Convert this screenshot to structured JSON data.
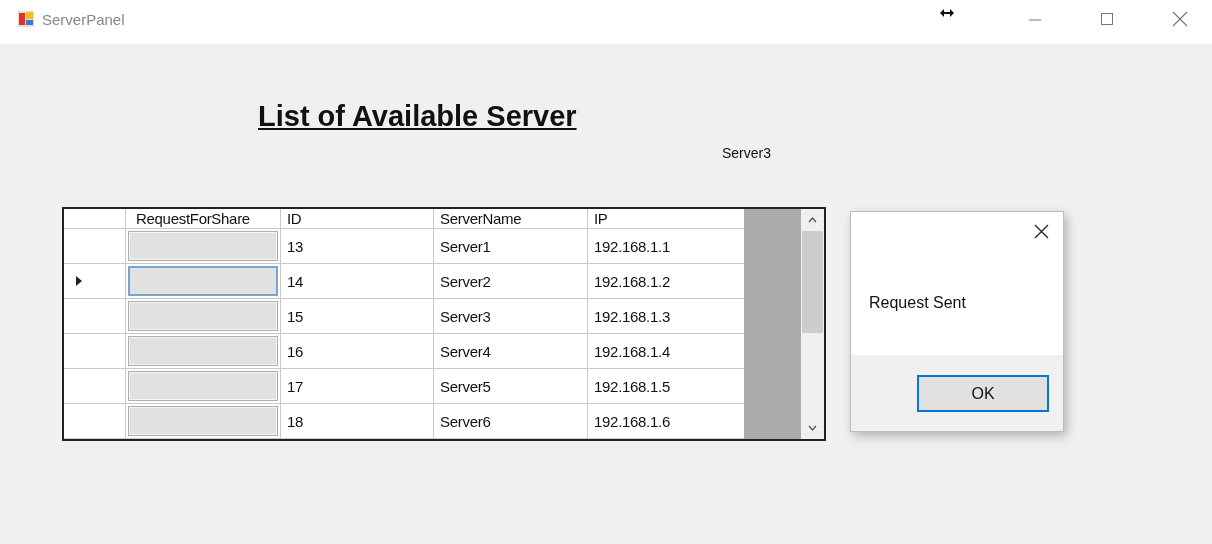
{
  "window": {
    "title": "ServerPanel"
  },
  "heading": "List of Available Server",
  "selected_server": "Server3",
  "table": {
    "columns": [
      "RequestForShare",
      "ID",
      "ServerName",
      "IP"
    ],
    "rows": [
      {
        "selected": false,
        "id": "13",
        "server_name": "Server1",
        "ip": "192.168.1.1"
      },
      {
        "selected": true,
        "id": "14",
        "server_name": "Server2",
        "ip": "192.168.1.2"
      },
      {
        "selected": false,
        "id": "15",
        "server_name": "Server3",
        "ip": "192.168.1.3"
      },
      {
        "selected": false,
        "id": "16",
        "server_name": "Server4",
        "ip": "192.168.1.4"
      },
      {
        "selected": false,
        "id": "17",
        "server_name": "Server5",
        "ip": "192.168.1.5"
      },
      {
        "selected": false,
        "id": "18",
        "server_name": "Server6",
        "ip": "192.168.1.6"
      }
    ]
  },
  "message_box": {
    "message": "Request Sent",
    "button": "OK"
  }
}
